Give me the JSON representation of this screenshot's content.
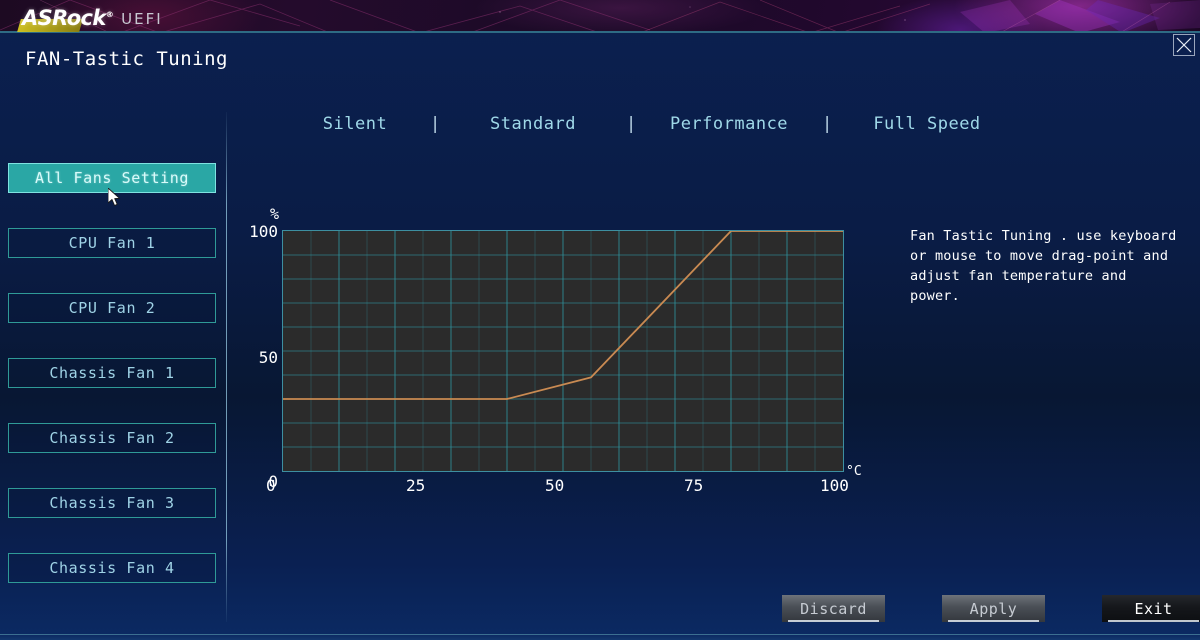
{
  "brand": {
    "name": "ASRock",
    "registered": "®",
    "suite": "UEFI"
  },
  "window": {
    "close_label": "close-window",
    "title": "FAN-Tastic Tuning"
  },
  "presets": {
    "separator": "|",
    "items": [
      {
        "label": "Silent"
      },
      {
        "label": "Standard"
      },
      {
        "label": "Performance"
      },
      {
        "label": "Full Speed"
      }
    ]
  },
  "sidebar": {
    "items": [
      {
        "label": "All Fans Setting",
        "selected": true
      },
      {
        "label": "CPU Fan 1",
        "selected": false
      },
      {
        "label": "CPU Fan 2",
        "selected": false
      },
      {
        "label": "Chassis Fan 1",
        "selected": false
      },
      {
        "label": "Chassis Fan 2",
        "selected": false
      },
      {
        "label": "Chassis Fan 3",
        "selected": false
      },
      {
        "label": "Chassis Fan 4",
        "selected": false
      }
    ]
  },
  "help": {
    "text": "Fan Tastic Tuning . use keyboard or mouse to move drag-point and adjust fan temperature and power."
  },
  "footer": {
    "discard_label": "Discard",
    "apply_label": "Apply",
    "exit_label": "Exit"
  },
  "colors": {
    "accent_teal": "#2aa7a5",
    "curve": "#c98a52",
    "grid": "#2f8f99",
    "plot_bg": "#2b2b2b",
    "text_cyan": "#9fd3e6",
    "panel_blue": "#0b2050"
  },
  "chart_data": {
    "type": "line",
    "title": "Fan speed curve",
    "xlabel": "°C",
    "ylabel": "%",
    "xlim": [
      0,
      100
    ],
    "ylim": [
      0,
      100
    ],
    "xticks": [
      0,
      25,
      50,
      75,
      100
    ],
    "xtick_labels": [
      "0",
      "25",
      "50",
      "75",
      "100"
    ],
    "yticks": [
      0,
      50,
      100
    ],
    "ytick_labels": [
      "0",
      "50",
      "100"
    ],
    "x_unit": "°C",
    "y_unit": "%",
    "grid": true,
    "grid_columns": 20,
    "grid_rows": 10,
    "legend": "none",
    "series": [
      {
        "name": "All Fans Setting",
        "color": "#c98a52",
        "x": [
          0,
          40,
          55,
          80,
          100
        ],
        "y": [
          30,
          30,
          39,
          100,
          100
        ]
      }
    ]
  }
}
